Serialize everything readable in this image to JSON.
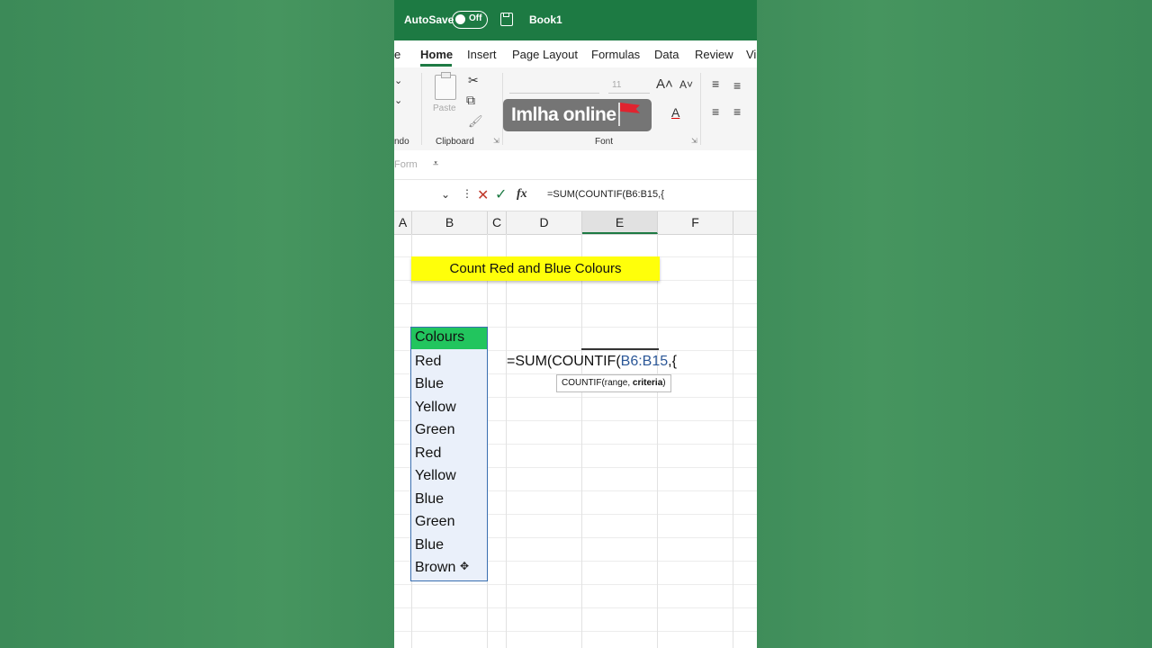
{
  "title_bar": {
    "autosave_label": "AutoSave",
    "autosave_state": "Off",
    "document_title": "Book1"
  },
  "tabs": [
    {
      "label": "e"
    },
    {
      "label": "Home"
    },
    {
      "label": "Insert"
    },
    {
      "label": "Page Layout"
    },
    {
      "label": "Formulas"
    },
    {
      "label": "Data"
    },
    {
      "label": "Review"
    },
    {
      "label": "Vi"
    }
  ],
  "ribbon": {
    "undo_group_label": "ndo",
    "paste_label": "Paste",
    "clipboard_label": "Clipboard",
    "font_size": "11",
    "font_group_label": "Font"
  },
  "watermark": {
    "text": "Imlha online"
  },
  "quick_access": {
    "form_label": "Form"
  },
  "formula_bar": {
    "formula": "=SUM(COUNTIF(B6:B15,{"
  },
  "column_headers": [
    "A",
    "B",
    "C",
    "D",
    "E",
    "F"
  ],
  "sheet": {
    "title": "Count Red and Blue Colours",
    "header": "Colours",
    "items": [
      "Red",
      "Blue",
      "Yellow",
      "Green",
      "Red",
      "Yellow",
      "Blue",
      "Green",
      "Blue",
      "Brown"
    ],
    "formula_prefix": "=SUM(COUNTIF(",
    "formula_ref": "B6:B15",
    "formula_suffix": ",{",
    "tooltip_plain": "COUNTIF(range, ",
    "tooltip_bold": "criteria",
    "tooltip_close": ")"
  },
  "colors": {
    "excel_green": "#1d7a43",
    "title_fill": "#ffff0a",
    "header_fill": "#22c55e",
    "range_border": "#3a6fb0"
  }
}
